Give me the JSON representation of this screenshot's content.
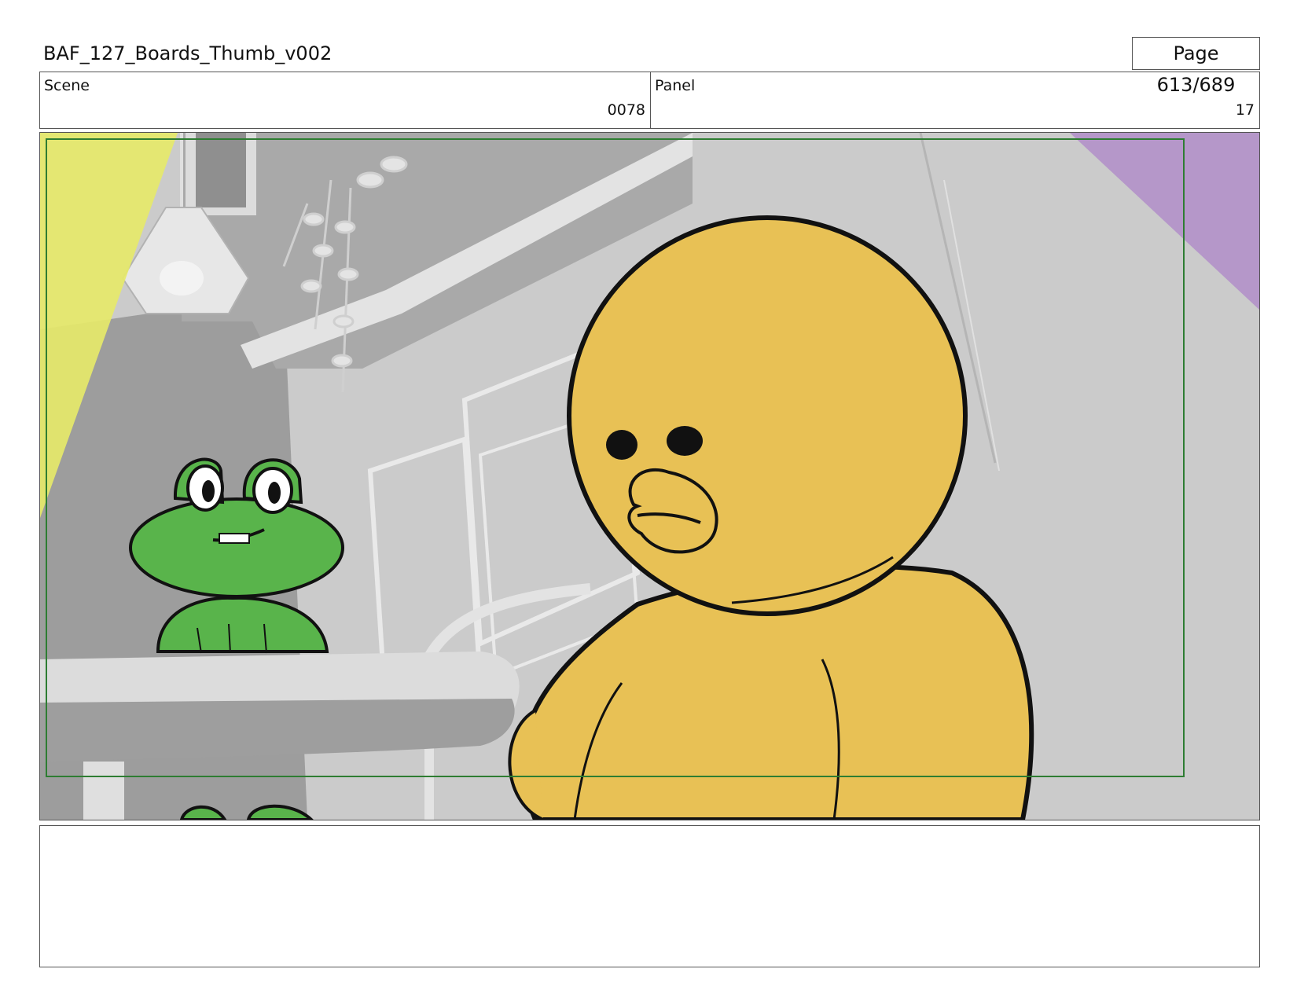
{
  "header": {
    "document_title": "BAF_127_Boards_Thumb_v002",
    "page_indicator": "Page 613/689"
  },
  "info": {
    "scene_label": "Scene",
    "scene_value": "0078",
    "panel_label": "Panel",
    "panel_value": "17"
  },
  "colors": {
    "safe_frame": "#2e7d32",
    "duck_body": "#e8c155",
    "frog_body": "#59b44b",
    "light_yellow": "#e6e96a",
    "light_purple": "#b597c9"
  },
  "notes": {
    "text": ""
  }
}
